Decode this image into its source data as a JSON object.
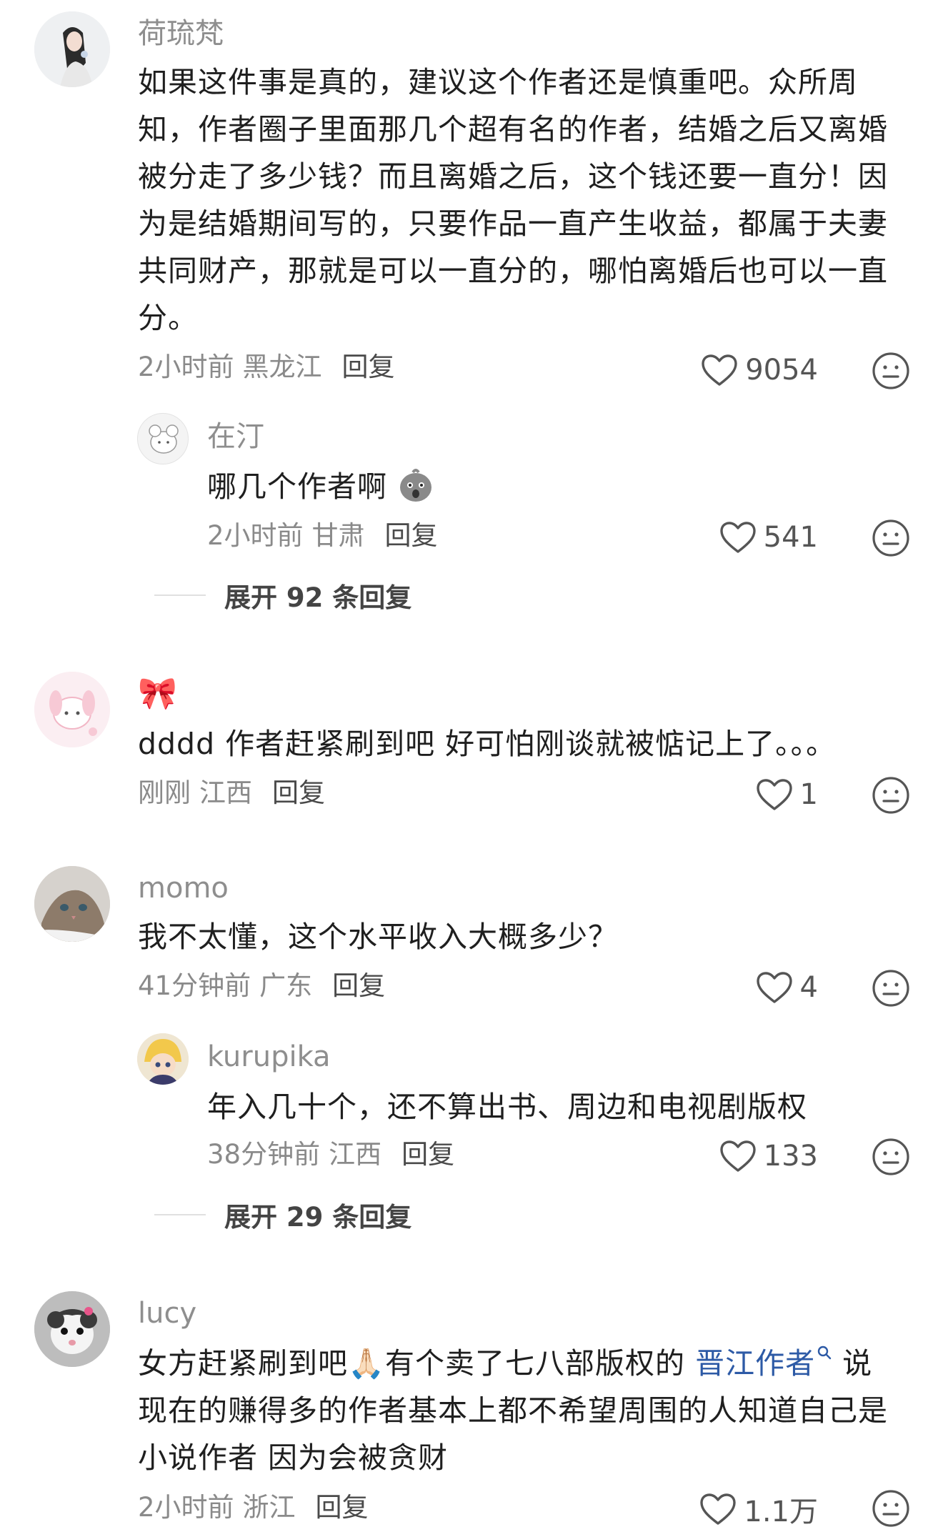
{
  "comments": [
    {
      "username": "荷琉梵",
      "text": "如果这件事是真的，建议这个作者还是慎重吧。众所周知，作者圈子里面那几个超有名的作者，结婚之后又离婚被分走了多少钱？而且离婚之后，这个钱还要一直分！因为是结婚期间写的，只要作品一直产生收益，都属于夫妻共同财产，那就是可以一直分的，哪怕离婚后也可以一直分。",
      "time": "2小时前",
      "location": "黑龙江",
      "reply_label": "回复",
      "likes": "9054",
      "replies": [
        {
          "username": "在汀",
          "text": "哪几个作者啊",
          "emoji_icon": "shocked-face-icon",
          "time": "2小时前",
          "location": "甘肃",
          "reply_label": "回复",
          "likes": "541"
        }
      ],
      "expand_label": "展开 92 条回复"
    },
    {
      "username": "🎀",
      "text": "dddd 作者赶紧刷到吧 好可怕刚谈就被惦记上了。。。",
      "time": "刚刚",
      "location": "江西",
      "reply_label": "回复",
      "likes": "1"
    },
    {
      "username": "momo",
      "text": "我不太懂，这个水平收入大概多少？",
      "time": "41分钟前",
      "location": "广东",
      "reply_label": "回复",
      "likes": "4",
      "replies": [
        {
          "username": "kurupika",
          "text": "年入几十个，还不算出书、周边和电视剧版权",
          "time": "38分钟前",
          "location": "江西",
          "reply_label": "回复",
          "likes": "133"
        }
      ],
      "expand_label": "展开 29 条回复"
    },
    {
      "username": "lucy",
      "text_before": "女方赶紧刷到吧🙏🏻有个卖了七八部版权的 ",
      "link": "晋江作者",
      "text_after": " 说现在的赚得多的作者基本上都不希望周围的人知道自己是小说作者 因为会被贪财",
      "time": "2小时前",
      "location": "浙江",
      "reply_label": "回复",
      "likes": "1.1万"
    }
  ],
  "icons": {
    "like": "heart-outline-icon",
    "reaction": "neutral-face-icon",
    "link_search": "search-icon"
  },
  "colors": {
    "link": "#2d5aa6",
    "username": "#8e8e8e",
    "meta": "#8a8a8a"
  }
}
